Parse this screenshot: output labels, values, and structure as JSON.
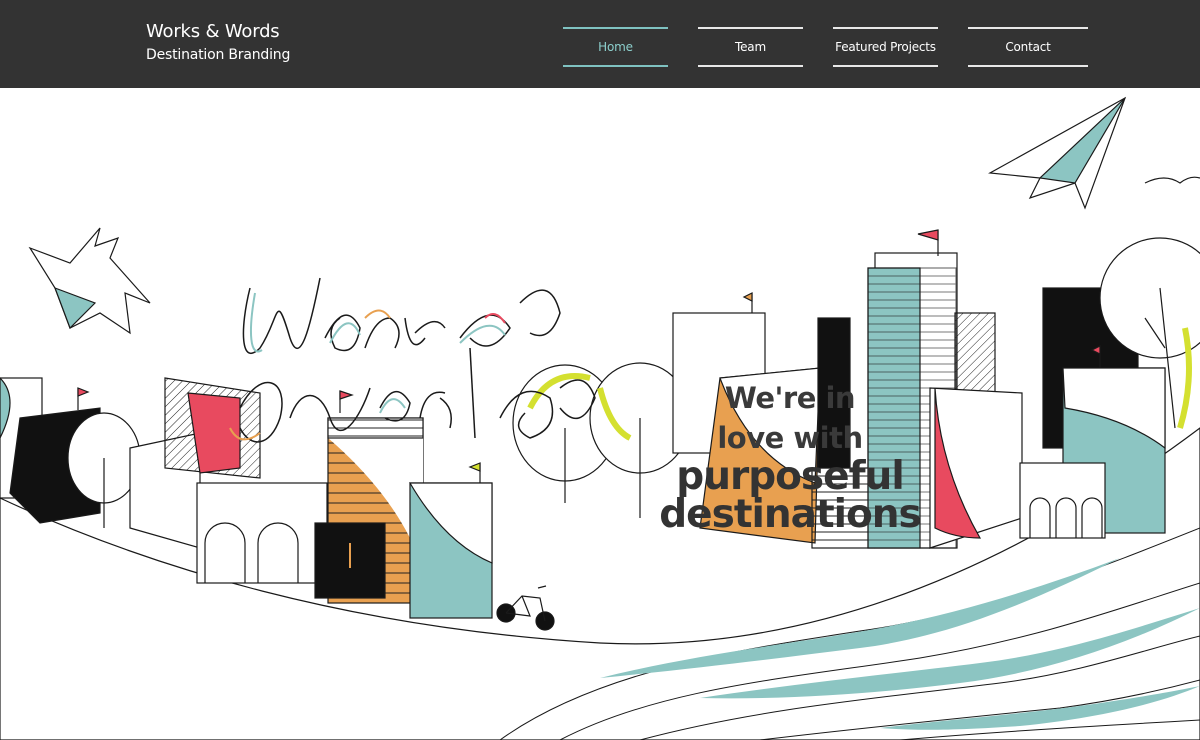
{
  "site": {
    "title": "Works & Words",
    "subtitle": "Destination Branding"
  },
  "nav": {
    "items": [
      {
        "label": "Home",
        "active": true
      },
      {
        "label": "Team",
        "active": false
      },
      {
        "label": "Featured Projects",
        "active": false
      },
      {
        "label": "Contact",
        "active": false
      }
    ]
  },
  "hero": {
    "headline_line1": "We're in",
    "headline_line2": "love with",
    "headline_line3": "purposeful",
    "headline_line4": "destinations",
    "illustration_icon": "city-illustration-icon"
  },
  "colors": {
    "header_bg": "#333333",
    "accent_teal": "#8cc5c2",
    "accent_orange": "#e8a050",
    "accent_red": "#e84a5f",
    "accent_lime": "#d4e030",
    "ink": "#1a1a1a"
  }
}
